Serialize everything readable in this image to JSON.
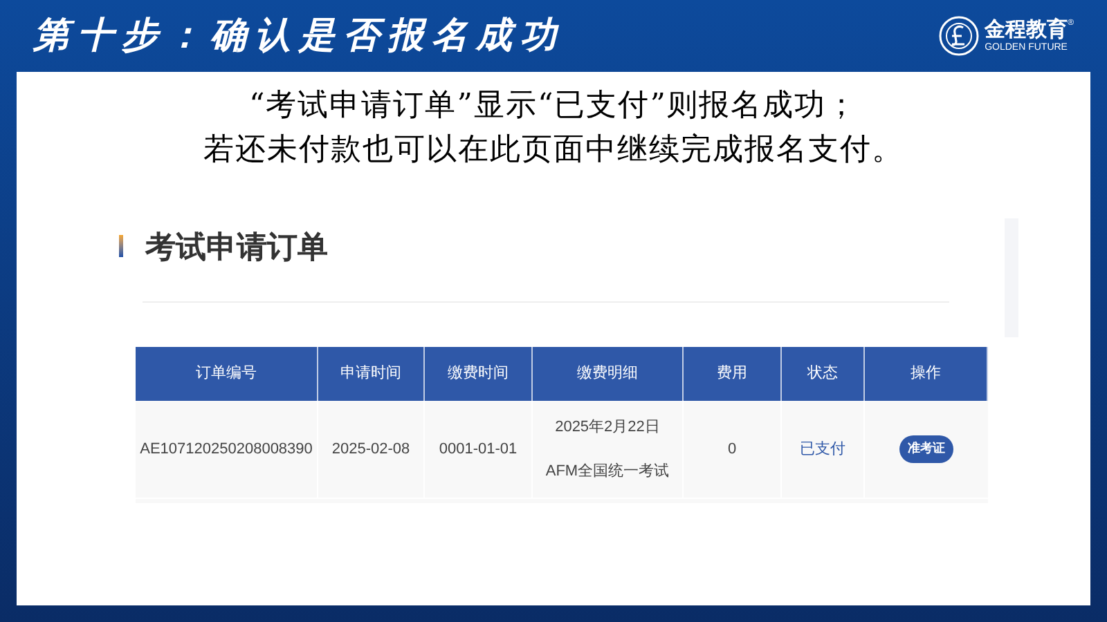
{
  "slide": {
    "title": "第十步：确认是否报名成功",
    "logo": {
      "name": "金程教育",
      "mark": "®",
      "tagline": "GOLDEN FUTURE"
    },
    "instructions": [
      "“考试申请订单”显示“已支付”则报名成功；",
      "若还未付款也可以在此页面中继续完成报名支付。"
    ]
  },
  "page": {
    "heading": "考试申请订单",
    "table": {
      "columns": [
        "订单编号",
        "申请时间",
        "缴费时间",
        "缴费明细",
        "费用",
        "状态",
        "操作"
      ],
      "rows": [
        {
          "cells": [
            "AE107120250208008390",
            "2025-02-08",
            "0001-01-01",
            "2025年2月22日AFM全国统一考试",
            "0"
          ],
          "status": {
            "text": "已支付",
            "paid": true
          },
          "action": "准考证"
        }
      ]
    }
  }
}
